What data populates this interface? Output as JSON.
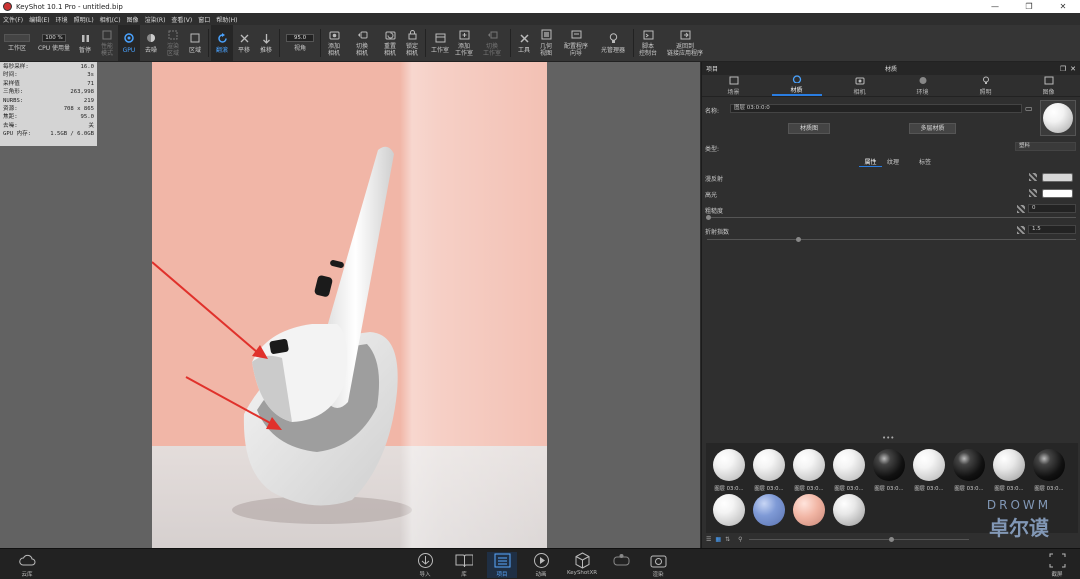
{
  "window": {
    "app_title": "KeyShot 10.1 Pro  - untitled.bip",
    "minimize": "—",
    "maximize": "❐",
    "close": "✕"
  },
  "menu": [
    "文件(F)",
    "编辑(E)",
    "环境",
    "照明(L)",
    "相机(C)",
    "图像",
    "渲染(R)",
    "查看(V)",
    "窗口",
    "帮助(H)"
  ],
  "toolbar": {
    "workspace_label": "工作区",
    "percent_value": "100 %",
    "cpu_label": "CPU 使用量",
    "pause_label": "暂停",
    "perf_mode_label": "性能\n模式",
    "gpu_label": "GPU",
    "denoise_label": "去噪",
    "render_label": "渲染\n区域",
    "region_label": "区域",
    "tumble_label": "翻滚",
    "pan_label": "平移",
    "dolly_label": "推移",
    "fov_value": "95.0",
    "fov_label": "视角",
    "add_camera_label": "添加\n相机",
    "switch_camera_label": "切换\n相机",
    "reset_camera_label": "重置\n相机",
    "lock_camera_label": "锁定\n相机",
    "studio_label": "工作室",
    "add_studio_label": "添加\n工作室",
    "switch_studio_label": "切换\n工作室",
    "tools_label": "工具",
    "geometry_view_label": "几何\n视图",
    "config_wizard_label": "配置程序\n向导",
    "light_manager_label": "光管理器",
    "script_console_label": "脚本\n控制台",
    "link_app_label": "返回到\n链接应用程序"
  },
  "stats": [
    {
      "k": "每秒采样:",
      "v": "16.0"
    },
    {
      "k": "时间:",
      "v": "3s"
    },
    {
      "k": "采样值",
      "v": "71"
    },
    {
      "k": "三角形:",
      "v": "263,998"
    },
    {
      "k": "NURBS:",
      "v": "219"
    },
    {
      "k": "资源:",
      "v": "708 x 865"
    },
    {
      "k": "焦距:",
      "v": "95.0"
    },
    {
      "k": "去噪:",
      "v": "关"
    },
    {
      "k": "GPU 内存:",
      "v": "1.5GB / 6.0GB"
    }
  ],
  "panel": {
    "left_label": "项目",
    "title": "材质",
    "tabs": [
      {
        "label": "场景",
        "icon": "scene-icon"
      },
      {
        "label": "材质",
        "icon": "material-icon"
      },
      {
        "label": "相机",
        "icon": "camera-icon"
      },
      {
        "label": "环境",
        "icon": "environment-icon"
      },
      {
        "label": "照明",
        "icon": "lighting-icon"
      },
      {
        "label": "图像",
        "icon": "image-icon"
      }
    ],
    "name_label": "名称:",
    "name_value": "图层 03:0:0:0",
    "material_graph_btn": "材质图",
    "multi_material_btn": "多层材质",
    "type_label": "类型:",
    "type_value": "塑料",
    "subtabs": [
      "属性",
      "纹理",
      "标签"
    ],
    "diffuse_label": "漫反射",
    "specular_label": "高光",
    "roughness_label": "粗糙度",
    "roughness_value": "0",
    "ior_label": "折射指数",
    "ior_value": "1.5",
    "colors": {
      "diffuse": "#d8d8d8",
      "specular": "#ffffff",
      "accent": "#2a7de1"
    }
  },
  "library": {
    "dots": "•••",
    "materials": [
      {
        "label": "图层 03:0...",
        "kind": "white"
      },
      {
        "label": "图层 03:0...",
        "kind": "white"
      },
      {
        "label": "图层 03:0...",
        "kind": "white"
      },
      {
        "label": "图层 03:0...",
        "kind": "white"
      },
      {
        "label": "图层 03:0...",
        "kind": "black"
      },
      {
        "label": "图层 03:0...",
        "kind": "white"
      },
      {
        "label": "图层 03:0...",
        "kind": "black"
      },
      {
        "label": "图层 03:0...",
        "kind": "grey"
      },
      {
        "label": "图层 03:0...",
        "kind": "black"
      },
      {
        "label": "",
        "kind": "white"
      },
      {
        "label": "",
        "kind": "blue"
      },
      {
        "label": "",
        "kind": "pink"
      },
      {
        "label": "",
        "kind": "grey"
      }
    ]
  },
  "bottom": {
    "cloud_label": "云库",
    "import_label": "导入",
    "library_label": "库",
    "project_label": "项目",
    "animation_label": "动画",
    "keyshotxr_label": "KeyShotXR",
    "render_label": "渲染",
    "screenshot_label": "截屏"
  },
  "watermark": {
    "line1": "DROWM",
    "line2": "卓尔谟"
  }
}
